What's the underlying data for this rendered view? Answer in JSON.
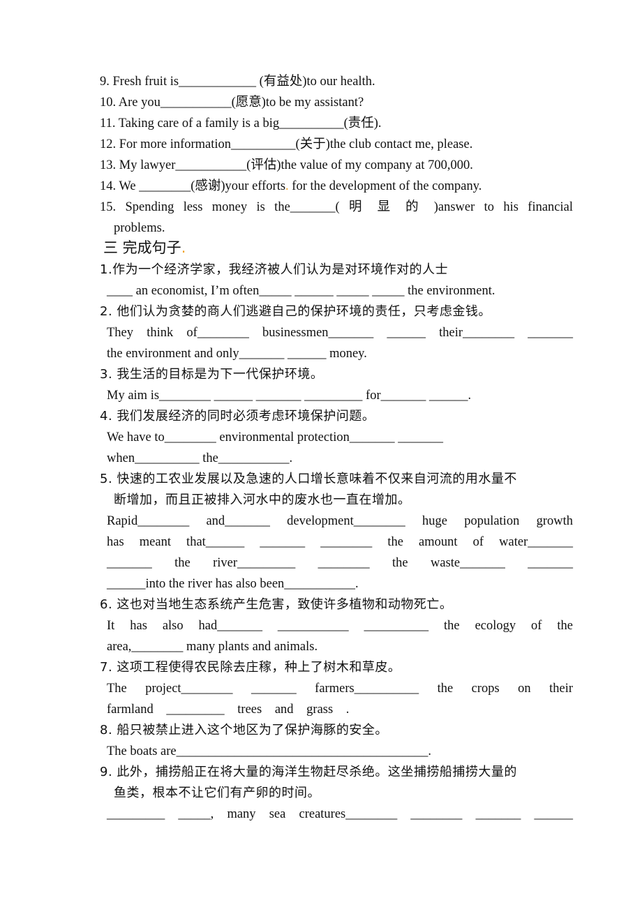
{
  "part2": {
    "items": [
      "9. Fresh fruit is____________ (有益处)to our health.",
      "10. Are you___________(愿意)to be my assistant?",
      "11. Taking care of a family is a big__________(责任).",
      "12. For more information__________(关于)the club contact me, please.",
      "13. My lawyer___________(评估)the value of my company at 700,000.",
      "14. We ________(感谢)your efforts",
      " for the development of the company.",
      "15. Spending less money is the_______( 明 显 的 )answer to his financial",
      "problems."
    ]
  },
  "part3": {
    "heading": "三  完成句子",
    "items": [
      {
        "cn": "1.作为一个经济学家，我经济被人们认为是对环境作对的人士",
        "en": [
          "____ an economist, I’m often_____ ______ _____ _____ the environment."
        ]
      },
      {
        "cn": "2. 他们认为贪婪的商人们逃避自己的保护环境的责任，只考虑金钱。",
        "en": [
          "They think of________ businessmen_______ ______ their________ _______",
          "the environment and only_______ ______ money."
        ]
      },
      {
        "cn": "3. 我生活的目标是为下一代保护环境。",
        "en": [
          "My aim is________ ______ _______ _________ for_______ ______."
        ]
      },
      {
        "cn": "4. 我们发展经济的同时必须考虑环境保护问题。",
        "en": [
          "We have to________ environmental protection_______ _______",
          "when__________ the___________."
        ]
      },
      {
        "cn": [
          "5. 快速的工农业发展以及急速的人口增长意味着不仅来自河流的用水量不",
          "断增加，而且正被排入河水中的废水也一直在增加。"
        ],
        "en": [
          "Rapid________ and_______ development________ huge population growth",
          "has meant that______ _______ ________ the amount of water_______",
          "_______ the river_________ ________ the waste_______ _______",
          "______into the river has also been___________."
        ]
      },
      {
        "cn": "6. 这也对当地生态系统产生危害，致使许多植物和动物死亡。",
        "en": [
          "It has also had_______ ___________ __________ the ecology of the",
          "area,________ many plants and animals."
        ]
      },
      {
        "cn": "7. 这项工程使得农民除去庄稼，种上了树木和草皮。",
        "en": [
          "The project________ _______ farmers__________ the crops on their",
          "farmland _________ trees and grass ."
        ]
      },
      {
        "cn": "8. 船只被禁止进入这个地区为了保护海豚的安全。",
        "en": [
          "The boats are_______________________________________."
        ]
      },
      {
        "cn": [
          "9. 此外，捕捞船正在将大量的海洋生物赶尽杀绝。这坐捕捞船捕捞大量的",
          "鱼类，根本不让它们有产卵的时间。"
        ],
        "en": [
          "_________ _____, many sea creatures________ ________ _______ ______"
        ]
      }
    ]
  },
  "accent_mark_color": "#f0a020"
}
